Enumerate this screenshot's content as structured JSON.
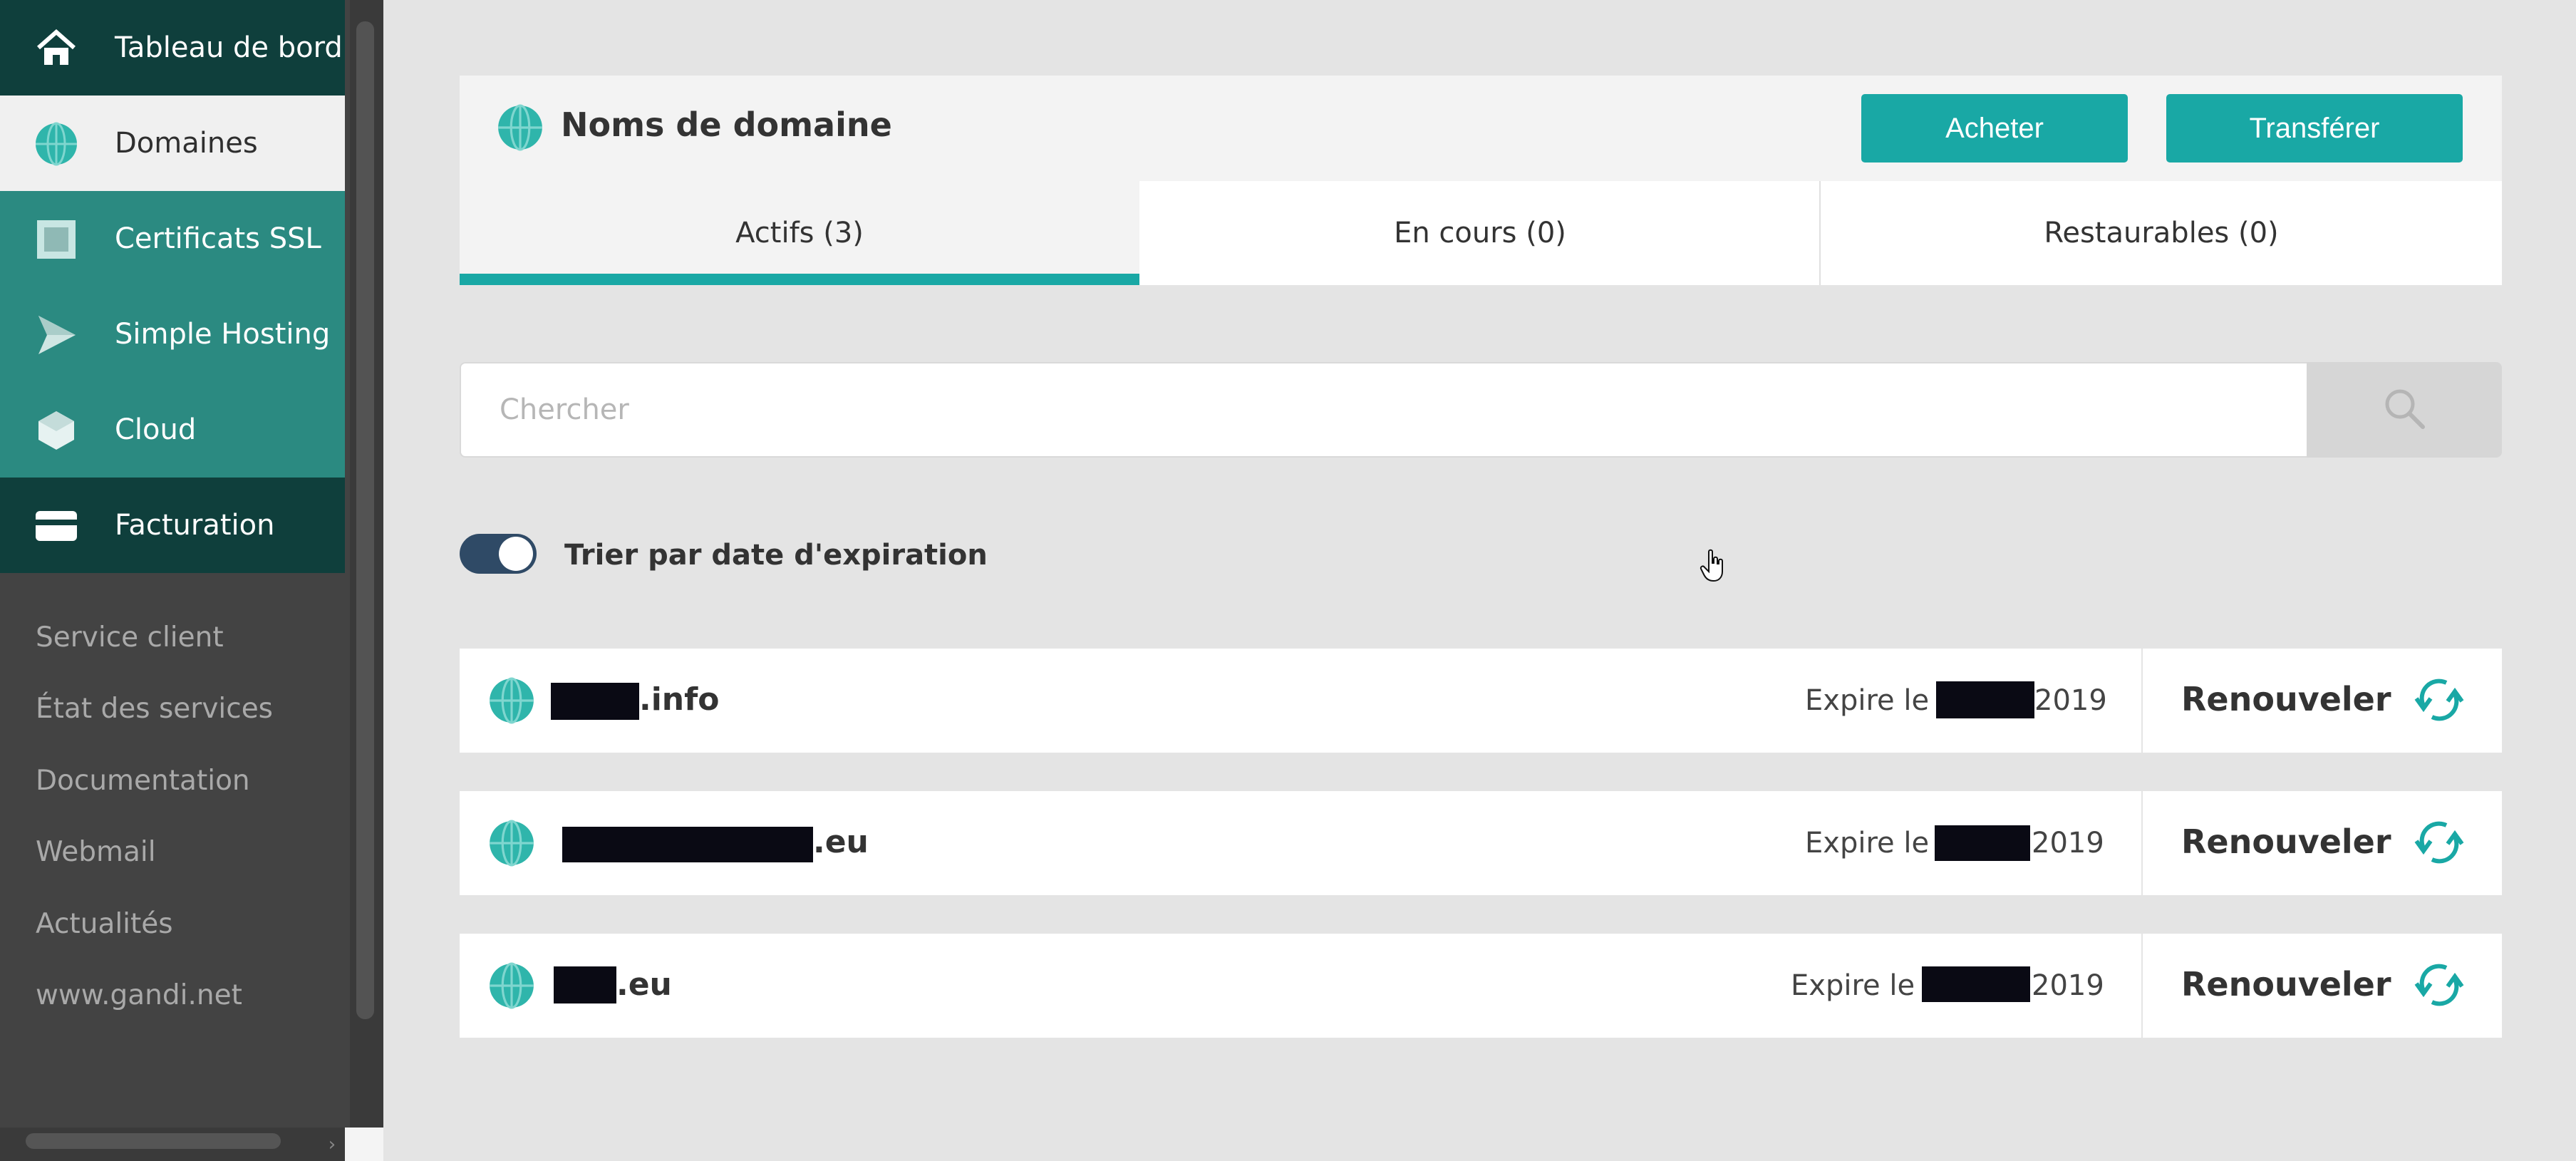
{
  "sidebar": {
    "nav": [
      {
        "label": "Tableau de bord",
        "icon": "home-icon"
      },
      {
        "label": "Domaines",
        "icon": "globe-icon"
      },
      {
        "label": "Certificats SSL",
        "icon": "certificate-icon"
      },
      {
        "label": "Simple Hosting",
        "icon": "paper-plane-icon"
      },
      {
        "label": "Cloud",
        "icon": "cube-icon"
      },
      {
        "label": "Facturation",
        "icon": "credit-card-icon"
      }
    ],
    "links": [
      "Service client",
      "État des services",
      "Documentation",
      "Webmail",
      "Actualités",
      "www.gandi.net"
    ]
  },
  "header": {
    "title": "Noms de domaine",
    "buy_label": "Acheter",
    "transfer_label": "Transférer"
  },
  "tabs": [
    "Actifs (3)",
    "En cours (0)",
    "Restaurables (0)"
  ],
  "search": {
    "placeholder": "Chercher"
  },
  "sort_toggle": {
    "label": "Trier par date d'expiration",
    "on": true
  },
  "domains": [
    {
      "tld": ".info",
      "expire_prefix": "Expire le",
      "expire_year": "2019",
      "renew_label": "Renouveler"
    },
    {
      "tld": ".eu",
      "expire_prefix": "Expire le",
      "expire_year": "2019",
      "renew_label": "Renouveler"
    },
    {
      "tld": ".eu",
      "expire_prefix": "Expire le",
      "expire_year": "2019",
      "renew_label": "Renouveler"
    }
  ],
  "colors": {
    "accent": "#19a8a5",
    "sidebar_bg": "#434343",
    "nav_dark": "#0f3f3c",
    "nav_teal": "#2b8a81",
    "toggle_on": "#2f4a66"
  }
}
